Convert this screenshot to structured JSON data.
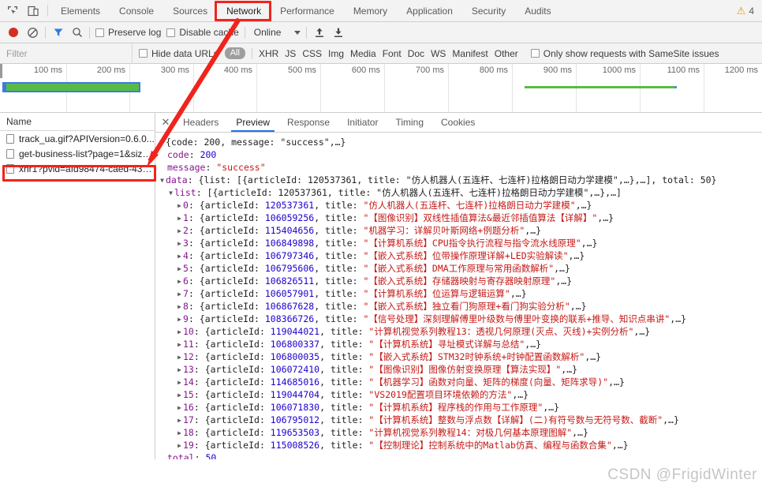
{
  "devtools": {
    "panel_tabs": [
      {
        "label": "Elements",
        "active": false
      },
      {
        "label": "Console",
        "active": false
      },
      {
        "label": "Sources",
        "active": false
      },
      {
        "label": "Network",
        "active": true
      },
      {
        "label": "Performance",
        "active": false
      },
      {
        "label": "Memory",
        "active": false
      },
      {
        "label": "Application",
        "active": false
      },
      {
        "label": "Security",
        "active": false
      },
      {
        "label": "Audits",
        "active": false
      }
    ],
    "warning_count": "4",
    "warning_icon": "warning-triangle-icon",
    "inspect_icon": "inspect-element-icon",
    "device_icon": "device-toolbar-icon",
    "accent_color": "#1a73e8"
  },
  "toolbar": {
    "record_icon": "record-button-icon",
    "clear_icon": "clear-network-log-icon",
    "filter_icon": "filter-funnel-icon",
    "search_icon": "search-magnifier-icon",
    "preserve_log_label": "Preserve log",
    "disable_cache_label": "Disable cache",
    "throttle_value": "Online",
    "import_icon": "import-har-icon",
    "export_icon": "export-har-icon"
  },
  "filterbar": {
    "filter_placeholder": "Filter",
    "filter_value": "",
    "hide_data_urls_label": "Hide data URLs",
    "types": [
      "All",
      "XHR",
      "JS",
      "CSS",
      "Img",
      "Media",
      "Font",
      "Doc",
      "WS",
      "Manifest",
      "Other"
    ],
    "active_type": "All",
    "samesite_label": "Only show requests with SameSite issues"
  },
  "overview": {
    "ticks": [
      "100 ms",
      "200 ms",
      "300 ms",
      "400 ms",
      "500 ms",
      "600 ms",
      "700 ms",
      "800 ms",
      "900 ms",
      "1000 ms",
      "1100 ms",
      "1200 ms"
    ],
    "bar_color": "#5aba47",
    "bar_border_color": "#3c7ce0"
  },
  "requests": {
    "column_header": "Name",
    "rows": [
      {
        "name": "track_ua.gif?APIVersion=0.6.0...",
        "selected": false
      },
      {
        "name": "get-business-list?page=1&size...",
        "selected": true
      },
      {
        "name": "xhr1?pvid=afd98474-caed-435...",
        "selected": false
      }
    ]
  },
  "detail": {
    "close_icon": "close-icon",
    "tabs": [
      {
        "label": "Headers",
        "active": false
      },
      {
        "label": "Preview",
        "active": true
      },
      {
        "label": "Response",
        "active": false
      },
      {
        "label": "Initiator",
        "active": false
      },
      {
        "label": "Timing",
        "active": false
      },
      {
        "label": "Cookies",
        "active": false
      }
    ]
  },
  "preview": {
    "root_summary": "{code: 200, message: \"success\",…}",
    "code_key": "code",
    "code_value": "200",
    "message_key": "message",
    "message_value": "\"success\"",
    "data_line": "data: {list: [{articleId: 120537361, title: \"仿人机器人(五连杆、七连杆)拉格朗日动力学建模\",…},…], total: 50}",
    "list_line": "list: [{articleId: 120537361, title: \"仿人机器人(五连杆、七连杆)拉格朗日动力学建模\",…},…]",
    "total_key": "total",
    "total_value": "50",
    "items": [
      {
        "index": "0",
        "articleId": "120537361",
        "title": "\"仿人机器人(五连杆、七连杆)拉格朗日动力学建模\""
      },
      {
        "index": "1",
        "articleId": "106059256",
        "title": "\"【图像识别】双线性插值算法&最近邻插值算法【详解】\""
      },
      {
        "index": "2",
        "articleId": "115404656",
        "title": "\"机器学习：详解贝叶斯网络+例题分析\""
      },
      {
        "index": "3",
        "articleId": "106849898",
        "title": "\"【计算机系统】CPU指令执行流程与指令流水线原理\""
      },
      {
        "index": "4",
        "articleId": "106797346",
        "title": "\"【嵌入式系统】位带操作原理详解+LED实验解读\""
      },
      {
        "index": "5",
        "articleId": "106795606",
        "title": "\"【嵌入式系统】DMA工作原理与常用函数解析\""
      },
      {
        "index": "6",
        "articleId": "106826511",
        "title": "\"【嵌入式系统】存储器映射与寄存器映射原理\""
      },
      {
        "index": "7",
        "articleId": "106057901",
        "title": "\"【计算机系统】位运算与逻辑运算\""
      },
      {
        "index": "8",
        "articleId": "106867628",
        "title": "\"【嵌入式系统】独立看门狗原理+看门狗实验分析\""
      },
      {
        "index": "9",
        "articleId": "108366726",
        "title": "\"【信号处理】深刻理解傅里叶级数与傅里叶变换的联系+推导、知识点串讲\""
      },
      {
        "index": "10",
        "articleId": "119044021",
        "title": "\"计算机视觉系列教程13：透视几何原理(灭点、灭线)+实例分析\""
      },
      {
        "index": "11",
        "articleId": "106800337",
        "title": "\"【计算机系统】寻址模式详解与总结\""
      },
      {
        "index": "12",
        "articleId": "106800035",
        "title": "\"【嵌入式系统】STM32时钟系统+时钟配置函数解析\""
      },
      {
        "index": "13",
        "articleId": "106072410",
        "title": "\"【图像识别】图像仿射变换原理【算法实现】\""
      },
      {
        "index": "14",
        "articleId": "114685016",
        "title": "\"【机器学习】函数对向量、矩阵的梯度(向量、矩阵求导)\""
      },
      {
        "index": "15",
        "articleId": "119044704",
        "title": "\"VS2019配置项目环境依赖的方法\""
      },
      {
        "index": "16",
        "articleId": "106071830",
        "title": "\"【计算机系统】程序栈的作用与工作原理\""
      },
      {
        "index": "17",
        "articleId": "106795012",
        "title": "\"【计算机系统】整数与浮点数【详解】(二)有符号数与无符号数、截断\""
      },
      {
        "index": "18",
        "articleId": "119653503",
        "title": "\"计算机视觉系列教程14：对极几何基本原理图解\""
      },
      {
        "index": "19",
        "articleId": "115008526",
        "title": "\"【控制理论】控制系统中的Matlab仿真、编程与函数合集\""
      }
    ]
  },
  "annotations": {
    "highlight_color": "#f0241c",
    "watermark": "CSDN @FrigidWinter"
  }
}
